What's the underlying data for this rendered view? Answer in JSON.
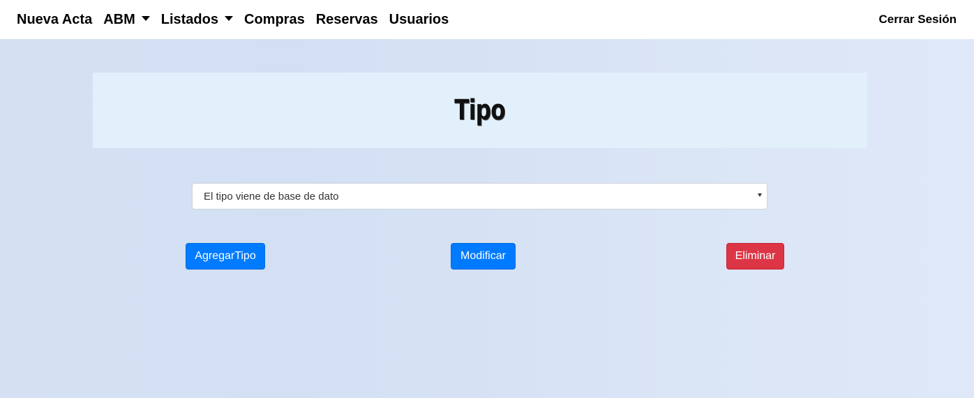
{
  "navbar": {
    "items": [
      {
        "label": "Nueva Acta",
        "dropdown": false
      },
      {
        "label": "ABM",
        "dropdown": true
      },
      {
        "label": "Listados",
        "dropdown": true
      },
      {
        "label": "Compras",
        "dropdown": false
      },
      {
        "label": "Reservas",
        "dropdown": false
      },
      {
        "label": "Usuarios",
        "dropdown": false
      }
    ],
    "logout_label": "Cerrar Sesión"
  },
  "page": {
    "title": "Tipo"
  },
  "tipo_select": {
    "selected_value": "El tipo viene de base de dato"
  },
  "actions": {
    "add_label": "AgregarTipo",
    "modify_label": "Modificar",
    "delete_label": "Eliminar"
  },
  "colors": {
    "primary": "#007bff",
    "danger": "#dc3545",
    "title_bg": "#e2f0fc",
    "page_bg": "#d5e1f3"
  }
}
